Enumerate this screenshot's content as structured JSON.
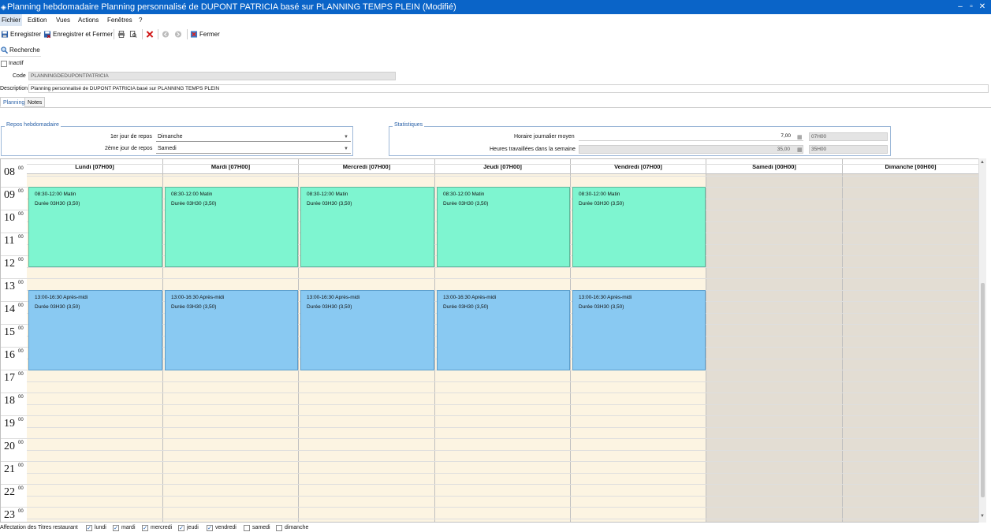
{
  "window": {
    "title": "Planning hebdomadaire Planning personnalisé de DUPONT PATRICIA basé sur PLANNING TEMPS PLEIN (Modifié)",
    "minimize": "–",
    "restore": "▫",
    "close": "✕"
  },
  "menu": [
    "Fichier",
    "Edition",
    "Vues",
    "Actions",
    "Fenêtres",
    "?"
  ],
  "toolbar": {
    "save": "Enregistrer",
    "save_close": "Enregistrer et Fermer",
    "close": "Fermer"
  },
  "search": {
    "label": "Recherche"
  },
  "form": {
    "inactive_label": "Inactif",
    "code_label": "Code",
    "code_value": "PLANNINGDEDUPONTPATRICIA",
    "description_label": "Description",
    "description_value": "Planning personnalisé de DUPONT PATRICIA basé sur PLANNING TEMPS PLEIN"
  },
  "tabs": [
    "Planning",
    "Notes"
  ],
  "repos": {
    "legend": "Repos hebdomadaire",
    "first_label": "1er jour de repos",
    "first_value": "Dimanche",
    "second_label": "2ème jour de repos",
    "second_value": "Samedi"
  },
  "stats": {
    "legend": "Statistiques",
    "daily_label": "Horaire journalier moyen",
    "daily_value": "7,00",
    "daily_hours": "07H00",
    "weekly_label": "Heures travaillées dans la semaine",
    "weekly_value": "35,00",
    "weekly_hours": "35H00"
  },
  "days": [
    {
      "label": "Lundi [07H00]",
      "rest": false
    },
    {
      "label": "Mardi [07H00]",
      "rest": false
    },
    {
      "label": "Mercredi [07H00]",
      "rest": false
    },
    {
      "label": "Jeudi [07H00]",
      "rest": false
    },
    {
      "label": "Vendredi [07H00]",
      "rest": false
    },
    {
      "label": "Samedi [00H00]",
      "rest": true
    },
    {
      "label": "Dimanche [00H00]",
      "rest": true
    }
  ],
  "hours": [
    "08",
    "09",
    "10",
    "11",
    "12",
    "13",
    "14",
    "15",
    "16",
    "17",
    "18",
    "19",
    "20",
    "21",
    "22",
    "23"
  ],
  "minutes_label": "00",
  "events": {
    "morning": {
      "title": "08:30-12:00 Matin",
      "duration": "Durée 03H30 (3,50)",
      "start": 8.5,
      "end": 12
    },
    "afternoon": {
      "title": "13:00-16:30 Après-midi",
      "duration": "Durée 03H30 (3,50)",
      "start": 13,
      "end": 16.5
    }
  },
  "footer": {
    "label": "Affectation des Titres restaurant",
    "days": [
      {
        "label": "lundi",
        "checked": true
      },
      {
        "label": "mardi",
        "checked": true
      },
      {
        "label": "mercredi",
        "checked": true
      },
      {
        "label": "jeudi",
        "checked": true
      },
      {
        "label": "vendredi",
        "checked": true
      },
      {
        "label": "samedi",
        "checked": false
      },
      {
        "label": "dimanche",
        "checked": false
      }
    ]
  },
  "colors": {
    "titlebar": "#0a64c8",
    "morning": "#7ef5d0",
    "afternoon": "#89c9f2",
    "workday_bg": "#fcf4e2",
    "rest_bg": "#e3ddd3"
  }
}
